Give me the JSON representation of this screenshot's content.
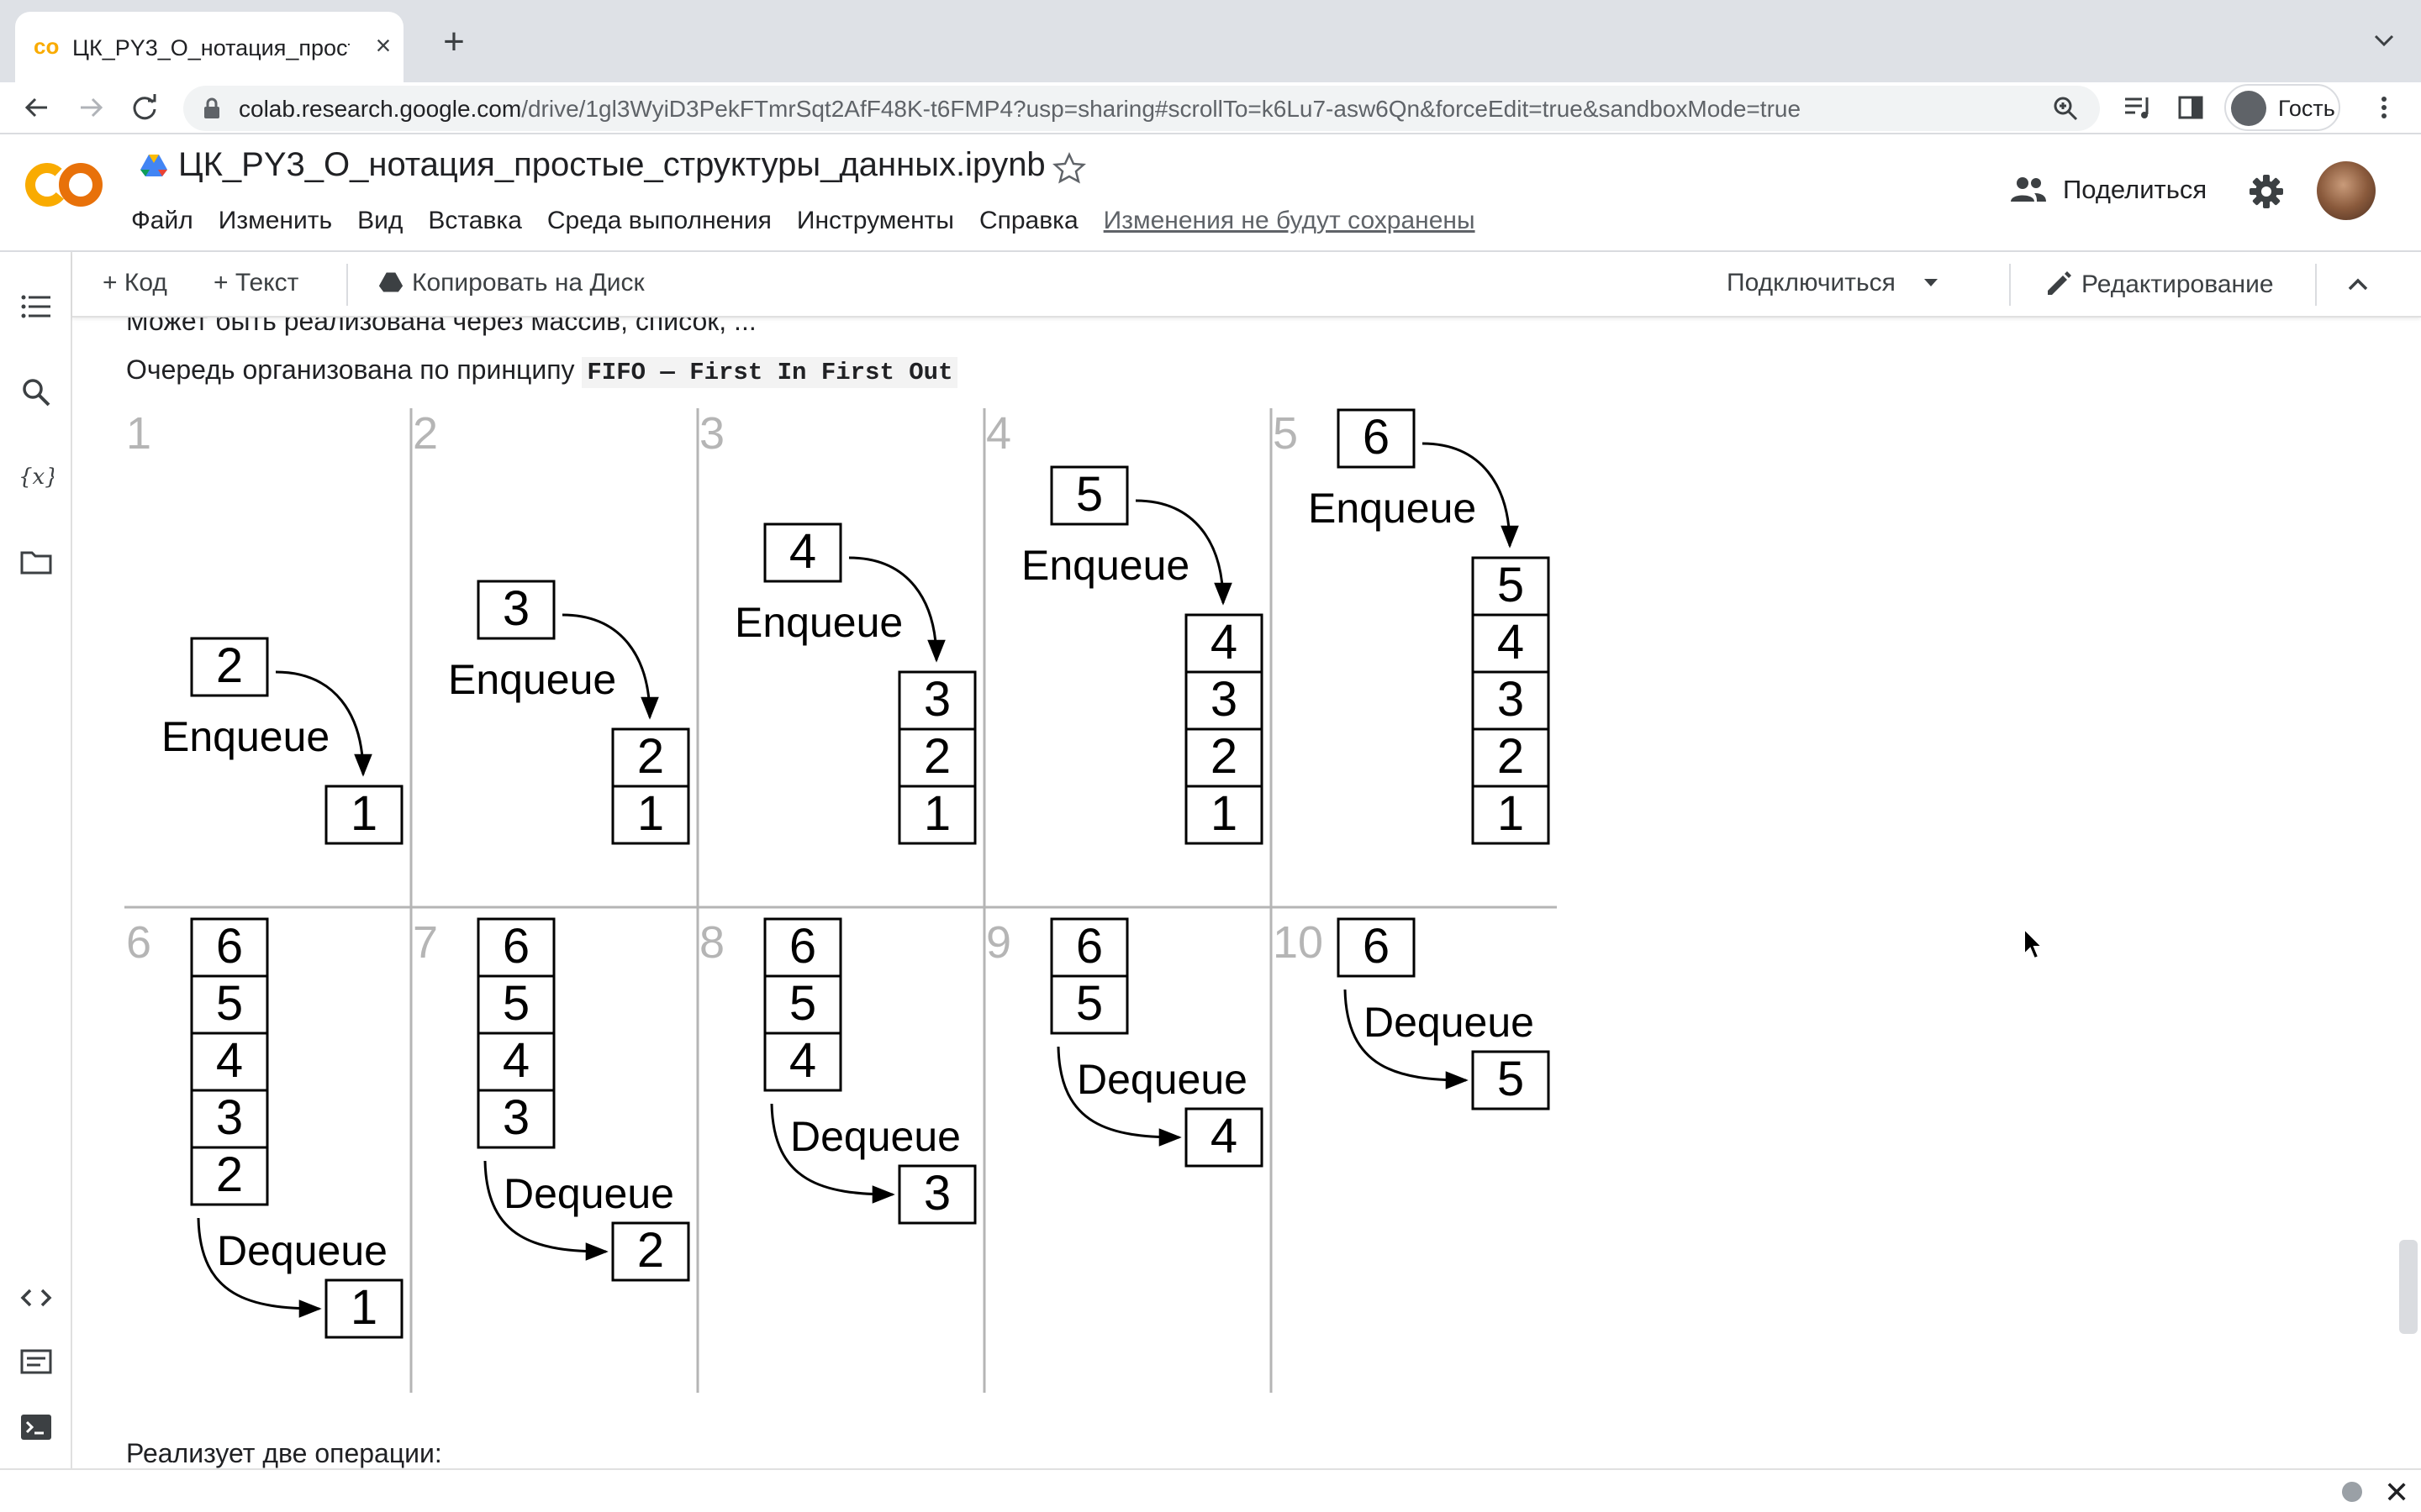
{
  "browser": {
    "tab_title": "ЦК_PY3_O_нотация_просты",
    "url_host": "colab.research.google.com",
    "url_path": "/drive/1gl3WyiD3PekFTmrSqt2AfF48K-t6FMP4?usp=sharing#scrollTo=k6Lu7-asw6Qn&forceEdit=true&sandboxMode=true",
    "profile_label": "Гость"
  },
  "colab": {
    "notebook_title": "ЦК_PY3_O_нотация_простые_структуры_данных.ipynb",
    "menu": [
      "Файл",
      "Изменить",
      "Вид",
      "Вставка",
      "Среда выполнения",
      "Инструменты",
      "Справка"
    ],
    "unsaved_notice": "Изменения не будут сохранены",
    "share_label": "Поделиться"
  },
  "toolbar": {
    "add_code": "+ Код",
    "add_text": "+ Текст",
    "copy_to_drive": "Копировать на Диск",
    "connect": "Подключиться",
    "editing": "Редактирование"
  },
  "content": {
    "line_top": "Может быть реализована через массив, список, ...",
    "line_fifo_prefix": "Очередь организована по принципу ",
    "line_fifo_code": "FIFO — First In First Out",
    "line_bottom": "Реализует две операции:"
  },
  "diagram": {
    "enqueue_label": "Enqueue",
    "dequeue_label": "Dequeue",
    "top_row": [
      {
        "step": "1",
        "incoming": "2",
        "stack": [
          "1"
        ]
      },
      {
        "step": "2",
        "incoming": "3",
        "stack": [
          "2",
          "1"
        ]
      },
      {
        "step": "3",
        "incoming": "4",
        "stack": [
          "3",
          "2",
          "1"
        ]
      },
      {
        "step": "4",
        "incoming": "5",
        "stack": [
          "4",
          "3",
          "2",
          "1"
        ]
      },
      {
        "step": "5",
        "incoming": "6",
        "stack": [
          "5",
          "4",
          "3",
          "2",
          "1"
        ]
      }
    ],
    "bottom_row": [
      {
        "step": "6",
        "stack": [
          "6",
          "5",
          "4",
          "3",
          "2"
        ],
        "outgoing": "1"
      },
      {
        "step": "7",
        "stack": [
          "6",
          "5",
          "4",
          "3"
        ],
        "outgoing": "2"
      },
      {
        "step": "8",
        "stack": [
          "6",
          "5",
          "4"
        ],
        "outgoing": "3"
      },
      {
        "step": "9",
        "stack": [
          "6",
          "5"
        ],
        "outgoing": "4"
      },
      {
        "step": "10",
        "stack": [
          "6"
        ],
        "outgoing": "5"
      }
    ]
  },
  "colors": {
    "accent_orange": "#f9ab00",
    "logo_orange": "#e8710a",
    "text": "#202124",
    "muted": "#5f6368"
  }
}
